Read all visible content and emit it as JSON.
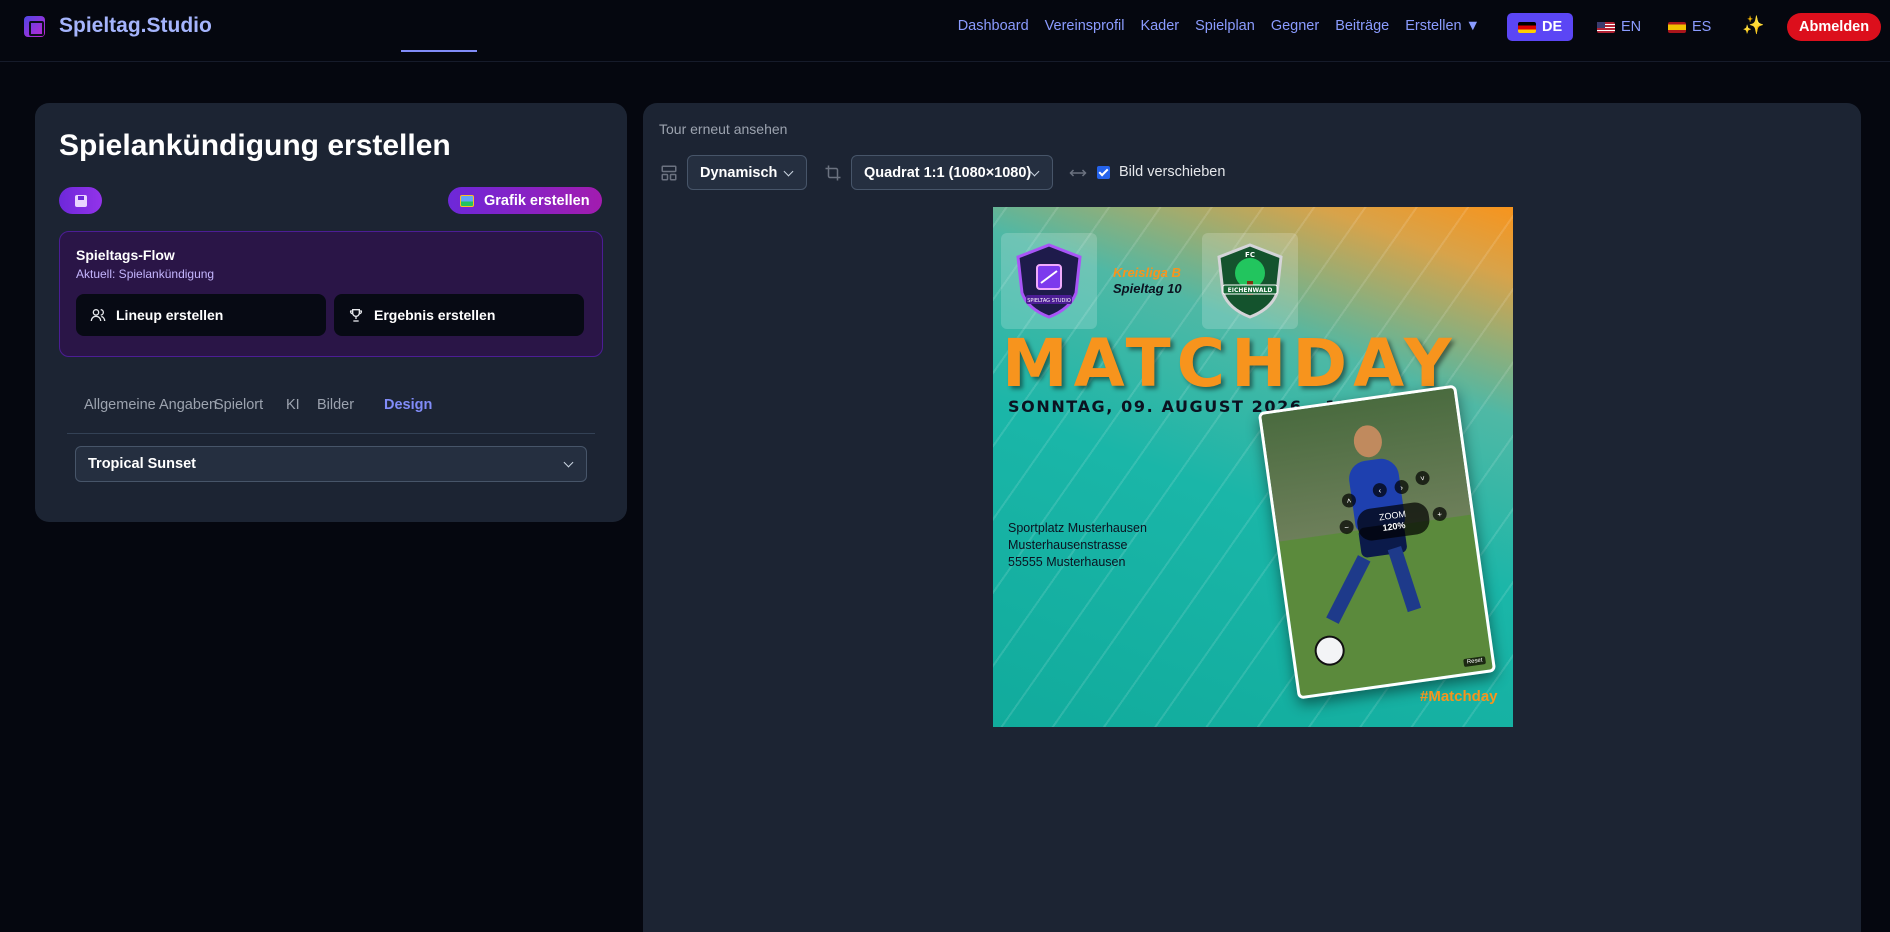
{
  "nav": {
    "brand": "Spieltag.Studio",
    "links": [
      "Dashboard",
      "Vereinsprofil",
      "Kader",
      "Spielplan",
      "Gegner",
      "Beiträge",
      "Erstellen ▼"
    ],
    "languages": [
      {
        "code": "DE",
        "active": true
      },
      {
        "code": "EN",
        "active": false
      },
      {
        "code": "ES",
        "active": false
      }
    ],
    "sparkle_icon": "sparkles-icon",
    "logout_label": "Abmelden"
  },
  "left": {
    "title": "Spielankündigung erstellen",
    "create_label": "Grafik erstellen",
    "flow": {
      "title": "Spieltags-Flow",
      "subtitle": "Aktuell: Spielankündigung",
      "lineup_label": "Lineup erstellen",
      "result_label": "Ergebnis erstellen"
    },
    "tabs": [
      "Allgemeine Angaben",
      "Spielort",
      "KI",
      "Bilder",
      "Design"
    ],
    "active_tab": "Design",
    "design_select": "Tropical Sunset"
  },
  "right": {
    "tour_label": "Tour erneut ansehen",
    "layout_select": "Dynamisch",
    "format_select": "Quadrat 1:1 (1080×1080)",
    "move_image_label": "Bild verschieben",
    "move_image_checked": true
  },
  "poster": {
    "home_logo_text": "SPIELTAG STUDIO",
    "away_logo_text": "FC EICHENWALD",
    "league": "Kreisliga B",
    "round": "Spieltag 10",
    "headline": "MATCHDAY",
    "date": "SONNTAG, 09. AUGUST 2026 - 15:00",
    "address": [
      "Sportplatz Musterhausen",
      "Musterhausenstrasse",
      "55555 Musterhausen"
    ],
    "zoom_label": "ZOOM",
    "zoom_value": "120%",
    "reset_label": "Reset",
    "hashtag": "#Matchday",
    "accent_color": "#f7941d",
    "base_color": "#11ab9c"
  }
}
